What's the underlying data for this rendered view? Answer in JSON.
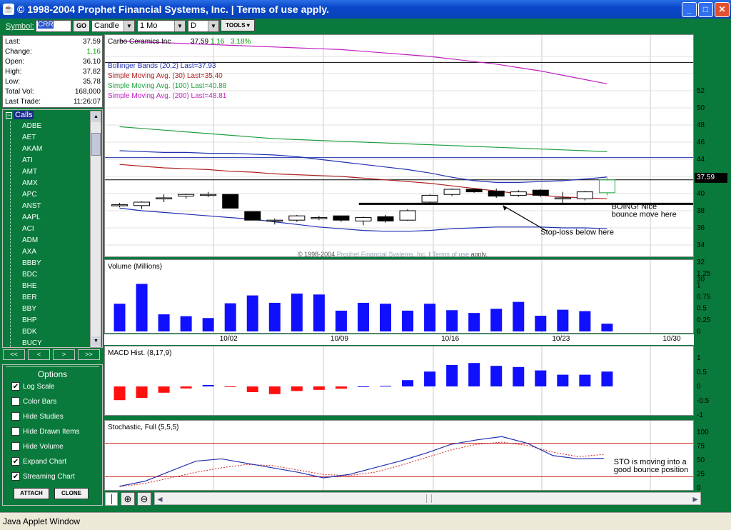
{
  "window": {
    "title": "© 1998-2004 Prophet Financial Systems, Inc.  |  Terms of use apply.",
    "buttons": {
      "minimize": "_",
      "maximize": "□",
      "close": "✕"
    }
  },
  "toolbar": {
    "symbol_label": "Symbol:",
    "symbol_value": "CRR",
    "go_label": "GO",
    "chart_type": "Candle",
    "period": "1 Mo",
    "interval": "D",
    "tools_label": "TOOLS ▾"
  },
  "quote": [
    {
      "label": "Last:",
      "value": "37.59",
      "color": "#000000"
    },
    {
      "label": "Change:",
      "value": "1.16",
      "color": "#00a000"
    },
    {
      "label": "Open:",
      "value": "36.10",
      "color": "#000000"
    },
    {
      "label": "High:",
      "value": "37.82",
      "color": "#000000"
    },
    {
      "label": "Low:",
      "value": "35.78",
      "color": "#000000"
    },
    {
      "label": "Total Vol:",
      "value": "168,000",
      "color": "#000000"
    },
    {
      "label": "Last Trade:",
      "value": "11:26:07",
      "color": "#000000"
    }
  ],
  "tree": {
    "root": "Calls",
    "items": [
      "ADBE",
      "AET",
      "AKAM",
      "ATI",
      "AMT",
      "AMX",
      "APC",
      "ANST",
      "AAPL",
      "ACI",
      "ADM",
      "AXA",
      "BBBY",
      "BDC",
      "BHE",
      "BER",
      "BBY",
      "BHP",
      "BDK",
      "BUCY"
    ]
  },
  "nav": [
    "<<",
    "<",
    ">",
    ">>"
  ],
  "options": {
    "title": "Options",
    "items": [
      {
        "label": "Log Scale",
        "checked": true
      },
      {
        "label": "Color Bars",
        "checked": false
      },
      {
        "label": "Hide Studies",
        "checked": false
      },
      {
        "label": "Hide Drawn Items",
        "checked": false
      },
      {
        "label": "Hide Volume",
        "checked": false
      },
      {
        "label": "Expand Chart",
        "checked": true
      },
      {
        "label": "Streaming Chart",
        "checked": true
      }
    ],
    "attach_label": "ATTACH",
    "clone_label": "CLONE"
  },
  "status": "Java Applet Window",
  "chart_data": [
    {
      "type": "candlestick",
      "header": {
        "name": "Carbo Ceramics Inc",
        "last": "37.59",
        "change": "1.16",
        "pct": "3.18%"
      },
      "legend": [
        {
          "text": "Bollinger Bands (20,2) Last=37.93",
          "color": "#2030b0"
        },
        {
          "text": "Simple Moving Avg. (30) Last=35.40",
          "color": "#b02020"
        },
        {
          "text": "Simple Moving Avg. (100) Last=40.88",
          "color": "#20a040"
        },
        {
          "text": "Simple Moving Avg. (200) Last=48.81",
          "color": "#c020c0"
        }
      ],
      "y_ticks": [
        52,
        50,
        48,
        46,
        44,
        42,
        40,
        38,
        36,
        34,
        32,
        30
      ],
      "ylim": [
        30,
        53
      ],
      "price_tag": "37.59",
      "candles": [
        {
          "o": 34.7,
          "h": 34.9,
          "l": 34.4,
          "c": 34.7
        },
        {
          "o": 34.6,
          "h": 35.1,
          "l": 34.2,
          "c": 35.0
        },
        {
          "o": 35.5,
          "h": 35.9,
          "l": 35.0,
          "c": 35.5
        },
        {
          "o": 35.7,
          "h": 36.0,
          "l": 35.4,
          "c": 35.9
        },
        {
          "o": 35.9,
          "h": 36.2,
          "l": 35.6,
          "c": 35.9
        },
        {
          "o": 35.9,
          "h": 35.9,
          "l": 34.3,
          "c": 34.3
        },
        {
          "o": 33.9,
          "h": 33.9,
          "l": 32.9,
          "c": 32.9
        },
        {
          "o": 32.9,
          "h": 33.1,
          "l": 32.4,
          "c": 32.9
        },
        {
          "o": 32.9,
          "h": 33.5,
          "l": 32.7,
          "c": 33.4
        },
        {
          "o": 33.2,
          "h": 33.4,
          "l": 32.9,
          "c": 33.2
        },
        {
          "o": 33.4,
          "h": 33.4,
          "l": 32.7,
          "c": 32.9
        },
        {
          "o": 32.8,
          "h": 33.3,
          "l": 32.3,
          "c": 33.2
        },
        {
          "o": 33.3,
          "h": 33.5,
          "l": 32.6,
          "c": 32.8
        },
        {
          "o": 32.9,
          "h": 34.2,
          "l": 32.8,
          "c": 34.0
        },
        {
          "o": 35.0,
          "h": 35.9,
          "l": 34.8,
          "c": 35.8
        },
        {
          "o": 35.9,
          "h": 36.6,
          "l": 35.7,
          "c": 36.5
        },
        {
          "o": 36.5,
          "h": 36.6,
          "l": 36.1,
          "c": 36.2
        },
        {
          "o": 36.3,
          "h": 36.6,
          "l": 35.5,
          "c": 35.7
        },
        {
          "o": 35.8,
          "h": 36.4,
          "l": 35.6,
          "c": 36.2
        },
        {
          "o": 36.4,
          "h": 36.5,
          "l": 35.6,
          "c": 35.8
        },
        {
          "o": 35.5,
          "h": 36.2,
          "l": 34.9,
          "c": 35.5
        },
        {
          "o": 35.4,
          "h": 36.3,
          "l": 35.2,
          "c": 36.2
        },
        {
          "o": 36.1,
          "h": 37.82,
          "l": 35.78,
          "c": 37.59
        }
      ],
      "sma200": [
        53.8,
        53.7,
        53.6,
        53.5,
        53.4,
        53.3,
        53.2,
        53.1,
        53.0,
        52.9,
        52.8,
        52.6,
        52.4,
        52.2,
        52.0,
        51.7,
        51.4,
        51.1,
        50.7,
        50.3,
        49.8,
        49.3,
        48.81
      ],
      "sma100": [
        43.8,
        43.6,
        43.4,
        43.2,
        43.0,
        42.8,
        42.6,
        42.4,
        42.3,
        42.2,
        42.1,
        42.0,
        41.9,
        41.8,
        41.7,
        41.6,
        41.5,
        41.4,
        41.3,
        41.2,
        41.1,
        41.0,
        40.88
      ],
      "sma30": [
        39.4,
        39.2,
        39.0,
        38.9,
        38.8,
        38.6,
        38.5,
        38.3,
        38.2,
        38.1,
        38.0,
        37.8,
        37.6,
        37.4,
        37.2,
        36.9,
        36.6,
        36.3,
        36.0,
        35.8,
        35.6,
        35.5,
        35.4
      ],
      "bb_upper": [
        41.0,
        40.9,
        40.8,
        40.8,
        40.7,
        40.7,
        40.6,
        40.5,
        40.3,
        40.0,
        39.7,
        39.4,
        39.1,
        38.8,
        38.4,
        37.9,
        37.5,
        37.3,
        37.3,
        37.4,
        37.5,
        37.7,
        37.93
      ],
      "bb_lower": [
        34.3,
        34.0,
        33.8,
        33.6,
        33.4,
        33.2,
        33.0,
        32.7,
        32.4,
        32.1,
        31.9,
        31.7,
        31.6,
        31.6,
        31.7,
        31.9,
        32.0,
        32.1,
        32.1,
        32.1,
        32.0,
        32.0,
        31.9
      ],
      "hlines": [
        {
          "value": 51.3,
          "color": "#000000"
        },
        {
          "value": 40.2,
          "color": "#2030b0"
        },
        {
          "value": 37.6,
          "color": "#000000"
        }
      ],
      "support": {
        "from_index": 10.8,
        "value": 34.8
      },
      "annotations": [
        {
          "text": "BOING!  Nice",
          "x": 22.2,
          "y": 34.2
        },
        {
          "text": "bounce move here",
          "x": 22.2,
          "y": 33.3
        },
        {
          "text": "Stop-loss below here",
          "x": 19.0,
          "y": 31.2
        }
      ],
      "footer": [
        "© 1998-2004 ",
        "Prophet Financial Systems, Inc.",
        " | ",
        "Terms of use",
        " apply."
      ]
    },
    {
      "type": "bar",
      "title": "Volume (Millions)",
      "y_ticks": [
        1.25,
        1,
        0.75,
        0.5,
        0.25,
        0
      ],
      "ylim": [
        0,
        1.3
      ],
      "values": [
        0.6,
        1.03,
        0.37,
        0.33,
        0.29,
        0.61,
        0.78,
        0.62,
        0.82,
        0.8,
        0.45,
        0.62,
        0.6,
        0.45,
        0.6,
        0.46,
        0.4,
        0.49,
        0.64,
        0.34,
        0.47,
        0.44,
        0.168
      ],
      "x_labels": [
        {
          "i": 5,
          "t": "10/02"
        },
        {
          "i": 10,
          "t": "10/09"
        },
        {
          "i": 15,
          "t": "10/16"
        },
        {
          "i": 20,
          "t": "10/23"
        },
        {
          "i": 25,
          "t": "10/30"
        }
      ]
    },
    {
      "type": "bar",
      "title": "MACD Hist. (8,17,9)",
      "y_ticks": [
        "1",
        "0.5",
        "0",
        "-0.5",
        "-1"
      ],
      "ylim": [
        -1,
        1
      ],
      "values": [
        -0.48,
        -0.4,
        -0.22,
        -0.07,
        0.05,
        -0.02,
        -0.2,
        -0.27,
        -0.16,
        -0.12,
        -0.08,
        0,
        0.02,
        0.22,
        0.52,
        0.75,
        0.82,
        0.72,
        0.68,
        0.56,
        0.41,
        0.41,
        0.52
      ]
    },
    {
      "type": "line",
      "title": "Stochastic, Full (5,5,5)",
      "y_ticks": [
        100,
        75,
        50,
        25,
        0
      ],
      "ylim": [
        0,
        100
      ],
      "hlines": [
        80,
        20
      ],
      "k": [
        3,
        12,
        30,
        48,
        52,
        44,
        36,
        28,
        18,
        24,
        36,
        48,
        62,
        78,
        86,
        92,
        80,
        58,
        52,
        53
      ],
      "d": [
        2,
        8,
        18,
        28,
        36,
        42,
        40,
        32,
        24,
        22,
        28,
        40,
        54,
        68,
        78,
        82,
        76,
        64,
        56,
        60
      ],
      "annotations": [
        {
          "text": "STO is moving into a",
          "x": 22.3,
          "y": 42
        },
        {
          "text": "good bounce position",
          "x": 22.3,
          "y": 28
        }
      ]
    }
  ]
}
